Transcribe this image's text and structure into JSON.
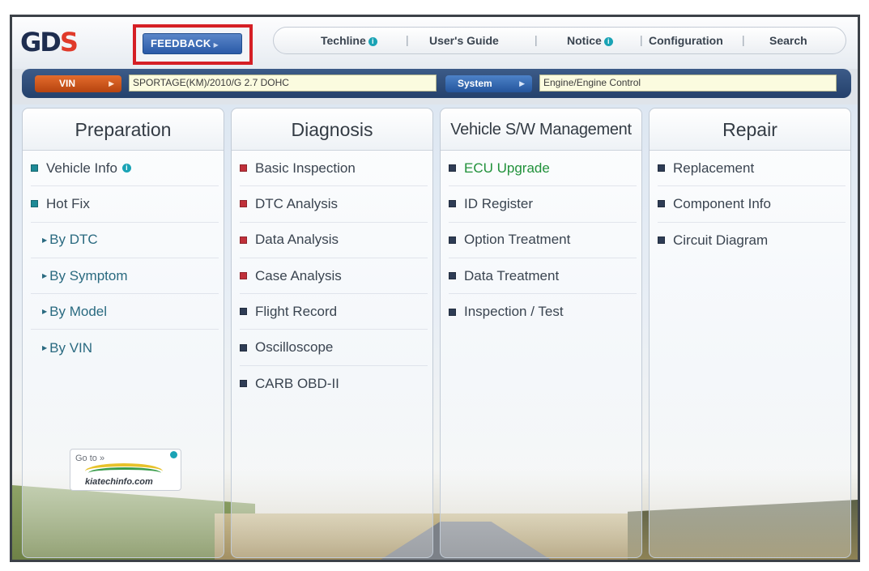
{
  "header": {
    "logo": {
      "main": "GD",
      "accent": "S"
    },
    "feedback_label": "FEEDBACK",
    "nav": [
      {
        "label": "Techline",
        "info": true
      },
      {
        "label": "User's Guide",
        "info": false
      },
      {
        "label": "Notice",
        "info": true
      },
      {
        "label": "Configuration",
        "info": false
      },
      {
        "label": "Search",
        "info": false
      }
    ]
  },
  "vehicle_bar": {
    "vin_label": "VIN",
    "vin_value": "SPORTAGE(KM)/2010/G 2.7 DOHC",
    "system_label": "System",
    "system_value": "Engine/Engine Control"
  },
  "panels": {
    "preparation": {
      "title": "Preparation",
      "items": [
        {
          "label": "Vehicle Info",
          "info": true
        },
        {
          "label": "Hot Fix"
        }
      ],
      "sub_items": [
        "By DTC",
        "By Symptom",
        "By Model",
        "By VIN"
      ],
      "badge": {
        "goto": "Go to",
        "site": "kiatechinfo.com"
      }
    },
    "diagnosis": {
      "title": "Diagnosis",
      "items": [
        "Basic Inspection",
        "DTC Analysis",
        "Data Analysis",
        "Case Analysis",
        "Flight Record",
        "Oscilloscope",
        "CARB OBD-II"
      ]
    },
    "vehicle_sw": {
      "title": "Vehicle S/W Management",
      "items": [
        "ECU Upgrade",
        "ID Register",
        "Option Treatment",
        "Data Treatment",
        "Inspection / Test"
      ]
    },
    "repair": {
      "title": "Repair",
      "items": [
        "Replacement",
        "Component Info",
        "Circuit Diagram"
      ]
    }
  },
  "colors": {
    "highlight_border": "#d51f25",
    "vin_button": "#d9591c",
    "system_button": "#3468b2",
    "field_bg": "#fbfbdf",
    "info_dot": "#1aa3b5",
    "active_item": "#20913a"
  }
}
